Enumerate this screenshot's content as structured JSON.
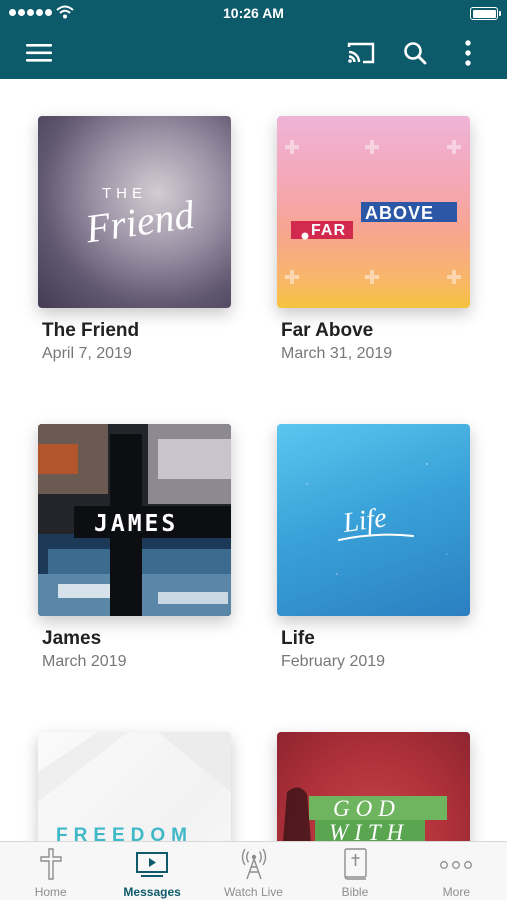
{
  "status_bar": {
    "time": "10:26 AM"
  },
  "colors": {
    "brand": "#0d5a6b",
    "tab_inactive": "#8e8e8e"
  },
  "header": {
    "icons": [
      "menu-icon",
      "cast-icon",
      "search-icon",
      "more-vertical-icon"
    ]
  },
  "messages": [
    {
      "title": "The Friend",
      "date": "April 7, 2019",
      "art_text": [
        "THE",
        "Friend"
      ]
    },
    {
      "title": "Far Above",
      "date": "March 31, 2019",
      "art_text": [
        "FAR",
        "ABOVE"
      ]
    },
    {
      "title": "James",
      "date": "March 2019",
      "art_text": [
        "JAMES"
      ]
    },
    {
      "title": "Life",
      "date": "February 2019",
      "art_text": [
        "Life"
      ]
    },
    {
      "art_text": [
        "FREEDOM"
      ]
    },
    {
      "art_text": [
        "GOD",
        "WITH"
      ]
    }
  ],
  "tab_bar": {
    "active": "Messages",
    "tabs": [
      {
        "label": "Home",
        "icon": "cross-icon"
      },
      {
        "label": "Messages",
        "icon": "video-icon"
      },
      {
        "label": "Watch Live",
        "icon": "broadcast-tower-icon"
      },
      {
        "label": "Bible",
        "icon": "bible-icon"
      },
      {
        "label": "More",
        "icon": "more-dots-icon"
      }
    ]
  }
}
